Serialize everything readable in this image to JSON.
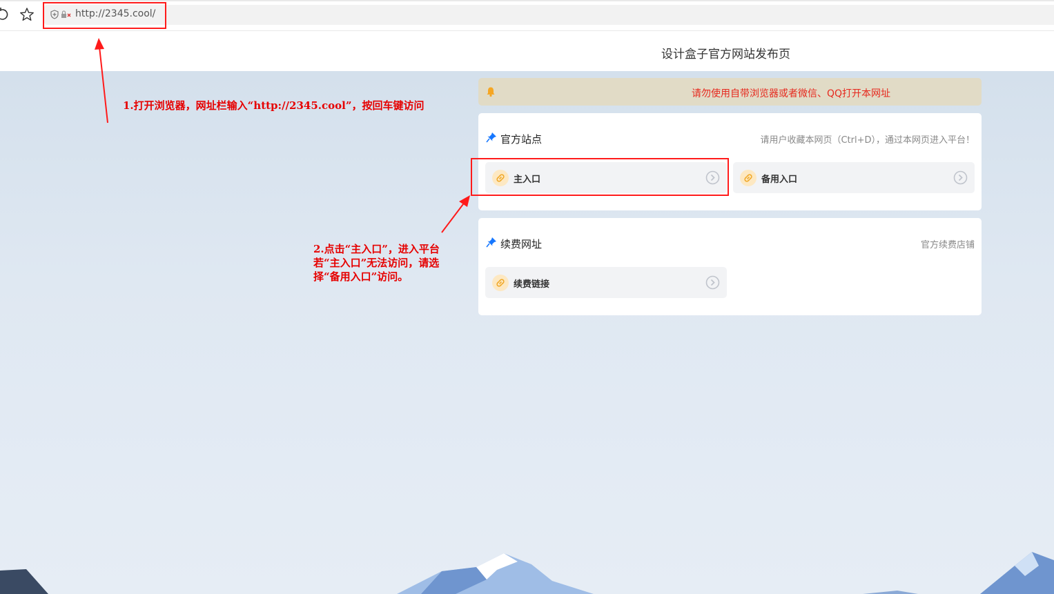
{
  "browser": {
    "url": "http://2345.cool/"
  },
  "page": {
    "title": "设计盒子官方网站发布页"
  },
  "notice": {
    "text": "请勿使用自带浏览器或者微信、QQ打开本网址"
  },
  "official": {
    "title": "官方站点",
    "subtitle": "请用户收藏本网页（Ctrl+D），通过本网页进入平台！",
    "links": [
      {
        "label": "主入口"
      },
      {
        "label": "备用入口"
      }
    ]
  },
  "renew": {
    "title": "续费网址",
    "subtitle": "官方续费店铺",
    "links": [
      {
        "label": "续费链接"
      }
    ]
  },
  "annotations": {
    "step1": "1.打开浏览器，网址栏输入“http://2345.cool”，按回车键访问",
    "step2_lines": [
      "2.点击“主入口”，进入平台",
      "若“主入口”无法访问，请选",
      "择“备用入口”访问。"
    ]
  },
  "colors": {
    "annotation_red": "#e60000",
    "notice_red": "#e6291e",
    "link_badge": "#fde8c2",
    "link_icon": "#f0a92a",
    "accent_blue": "#1677ff"
  }
}
